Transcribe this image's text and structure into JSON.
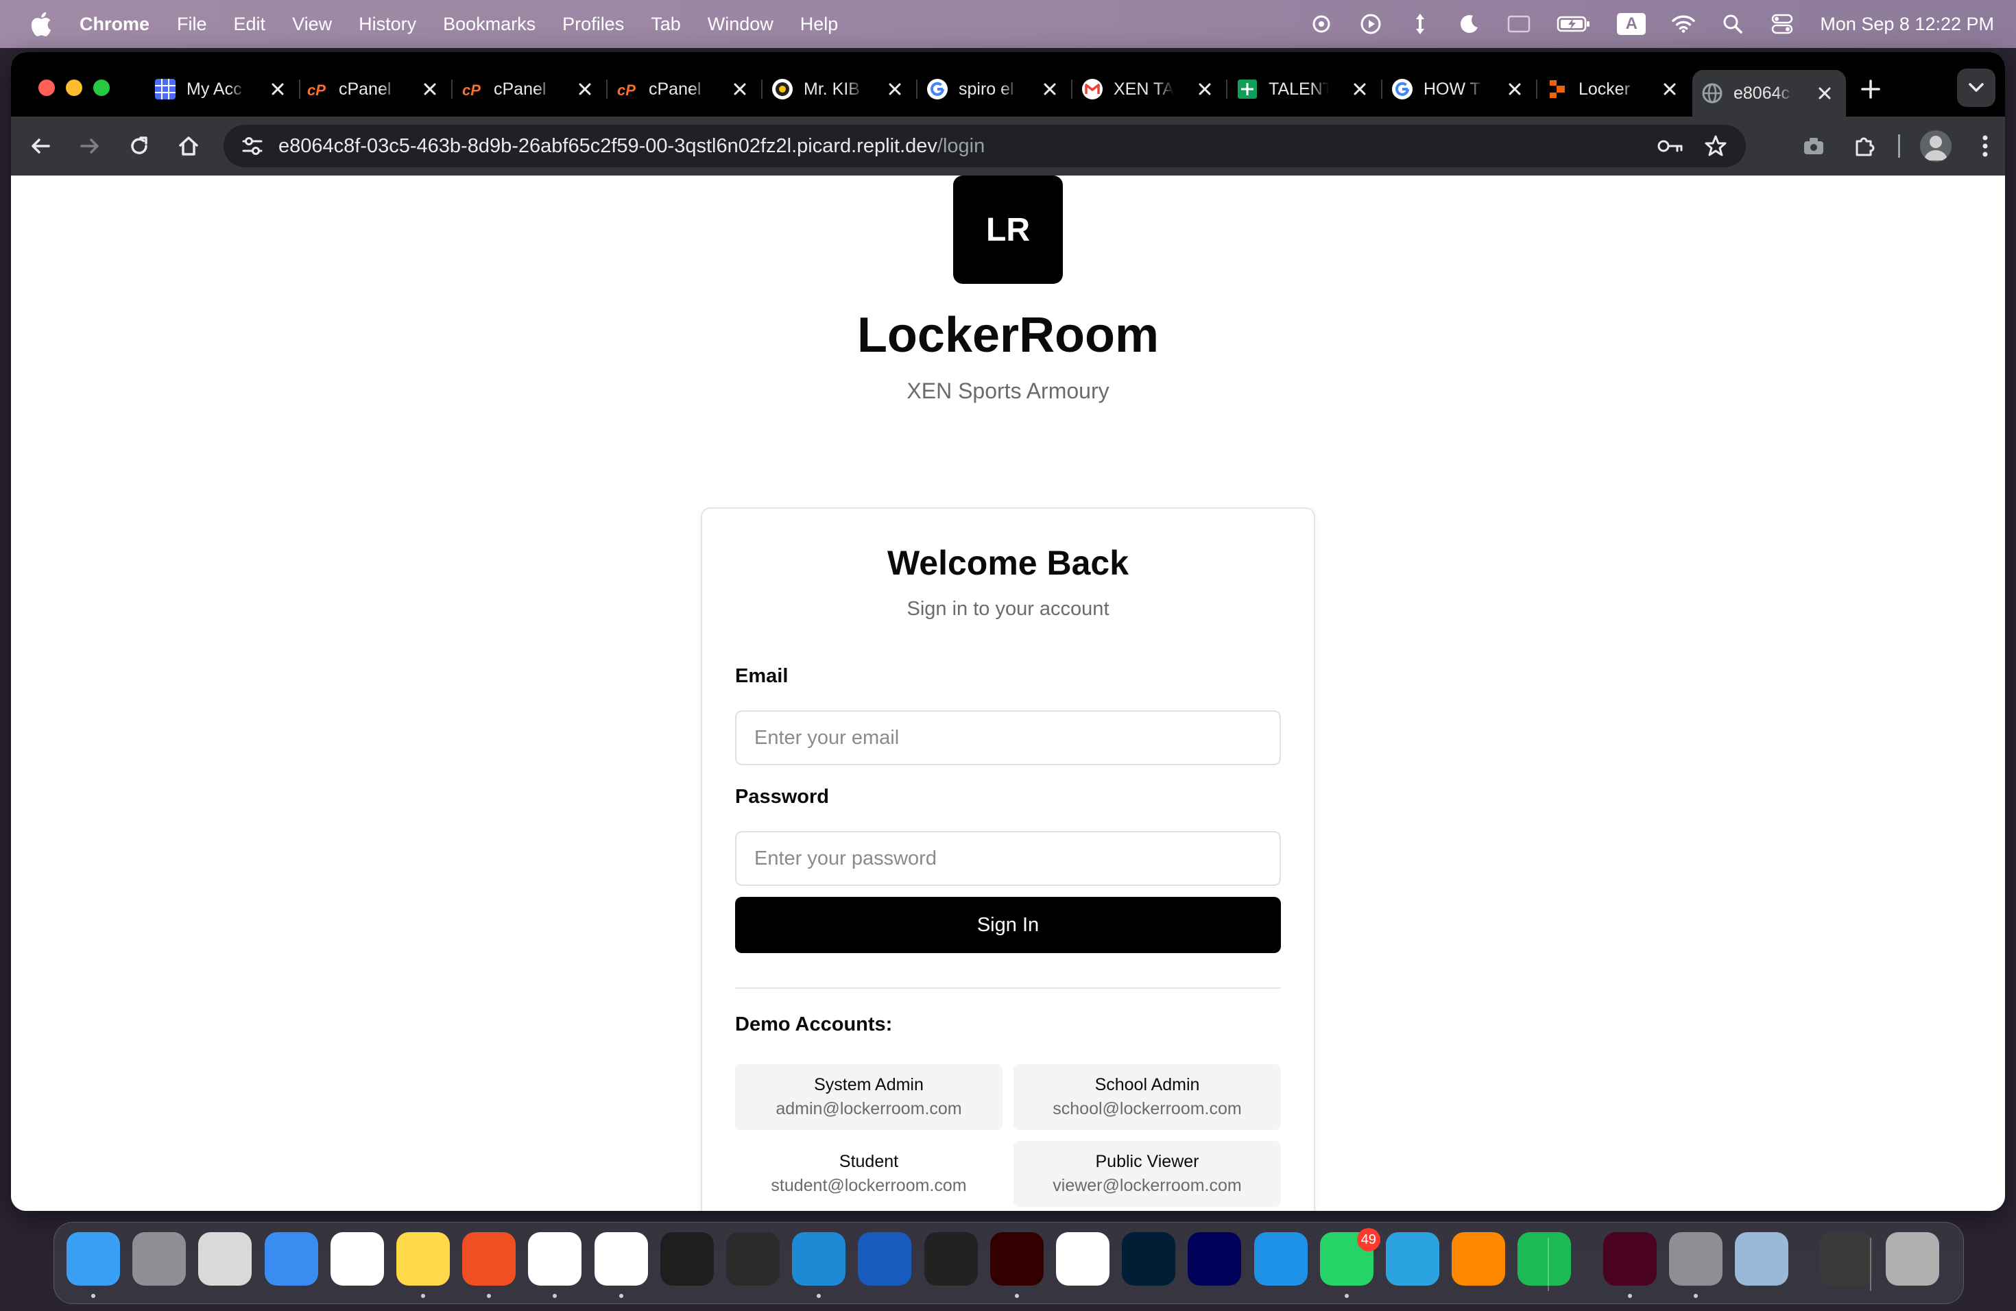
{
  "menubar": {
    "app_name": "Chrome",
    "menus": [
      "File",
      "Edit",
      "View",
      "History",
      "Bookmarks",
      "Profiles",
      "Tab",
      "Window",
      "Help"
    ],
    "clock": "Mon Sep 8  12:22 PM",
    "input_source": "A"
  },
  "tabs": [
    {
      "label": "My Acc",
      "icon": "grid-icon",
      "color": "#4a6cf7"
    },
    {
      "label": "cPanel",
      "icon": "cpanel-icon",
      "color": "#ff6c2c"
    },
    {
      "label": "cPanel",
      "icon": "cpanel-icon",
      "color": "#ff6c2c"
    },
    {
      "label": "cPanel",
      "icon": "cpanel-icon",
      "color": "#ff6c2c"
    },
    {
      "label": "Mr. KIB",
      "icon": "avatar-icon",
      "color": "#ffffff"
    },
    {
      "label": "spiro el",
      "icon": "google-icon",
      "color": "#ffffff"
    },
    {
      "label": "XEN TA",
      "icon": "gmail-icon",
      "color": "#ea4335"
    },
    {
      "label": "TALENT",
      "icon": "sheets-icon",
      "color": "#0f9d58"
    },
    {
      "label": "HOW T",
      "icon": "google-icon",
      "color": "#ffffff"
    },
    {
      "label": "Locker",
      "icon": "replit-icon",
      "color": "#f26207"
    },
    {
      "label": "e8064c",
      "icon": "globe-icon",
      "color": "#9aa0a6"
    }
  ],
  "address_bar": {
    "host": "e8064c8f-03c5-463b-8d9b-26abf65c2f59-00-3qstl6n02fz2l.picard.replit.dev",
    "path": "/login"
  },
  "brand": {
    "logo_initials": "LR",
    "title": "LockerRoom",
    "subtitle": "XEN Sports Armoury"
  },
  "login": {
    "title": "Welcome Back",
    "subtitle": "Sign in to your account",
    "email_label": "Email",
    "email_placeholder": "Enter your email",
    "password_label": "Password",
    "password_placeholder": "Enter your password",
    "submit_label": "Sign In"
  },
  "demo": {
    "title": "Demo Accounts:",
    "accounts": [
      {
        "role": "System Admin",
        "email": "admin@lockerroom.com"
      },
      {
        "role": "School Admin",
        "email": "school@lockerroom.com"
      },
      {
        "role": "Student",
        "email": "student@lockerroom.com"
      },
      {
        "role": "Public Viewer",
        "email": "viewer@lockerroom.com"
      }
    ]
  },
  "dock": {
    "apps": [
      {
        "name": "finder-icon",
        "color": "#3aa0f5"
      },
      {
        "name": "font-book-icon",
        "color": "#8e8e93"
      },
      {
        "name": "launchpad-icon",
        "color": "#d9d9d9"
      },
      {
        "name": "mail-icon",
        "color": "#3b8cf0"
      },
      {
        "name": "reminders-icon",
        "color": "#ffffff"
      },
      {
        "name": "notes-icon",
        "color": "#ffd94a"
      },
      {
        "name": "brave-icon",
        "color": "#f04e23"
      },
      {
        "name": "chrome-icon",
        "color": "#ffffff"
      },
      {
        "name": "chatgpt-icon",
        "color": "#ffffff"
      },
      {
        "name": "terminal-icon",
        "color": "#1e1e1e"
      },
      {
        "name": "dev-app-icon",
        "color": "#2b2b2b"
      },
      {
        "name": "vscode-icon",
        "color": "#1e8ad6"
      },
      {
        "name": "word-icon",
        "color": "#185abd"
      },
      {
        "name": "photos-app-icon",
        "color": "#222222"
      },
      {
        "name": "illustrator-icon",
        "color": "#330000"
      },
      {
        "name": "capcut-icon",
        "color": "#ffffff"
      },
      {
        "name": "photoshop-icon",
        "color": "#001e36"
      },
      {
        "name": "after-effects-icon",
        "color": "#00005b"
      },
      {
        "name": "docker-icon",
        "color": "#1d91e6"
      },
      {
        "name": "whatsapp-icon",
        "color": "#25d366"
      },
      {
        "name": "telegram-icon",
        "color": "#2aa3df"
      },
      {
        "name": "vlc-icon",
        "color": "#ff8800"
      },
      {
        "name": "spotify-icon",
        "color": "#1db954"
      },
      {
        "name": "indesign-icon",
        "color": "#49021f"
      },
      {
        "name": "system-settings-icon",
        "color": "#8e8e93"
      },
      {
        "name": "preview-icon",
        "color": "#9ab8d8"
      },
      {
        "name": "downloads-stack-icon",
        "color": "#3a3a3a"
      },
      {
        "name": "trash-icon",
        "color": "#b0b0b0"
      }
    ],
    "whatsapp_badge": "49"
  }
}
